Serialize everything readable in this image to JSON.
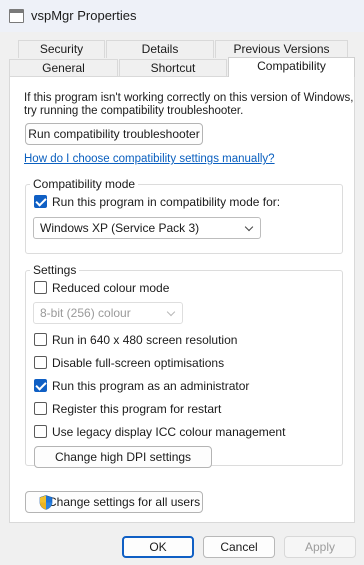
{
  "window": {
    "title": "vspMgr Properties"
  },
  "tabs": {
    "row1": [
      "Security",
      "Details",
      "Previous Versions"
    ],
    "row2": [
      "General",
      "Shortcut",
      "Compatibility"
    ],
    "active": "Compatibility"
  },
  "compat": {
    "intro_line1": "If this program isn't working correctly on this version of Windows,",
    "intro_line2": "try running the compatibility troubleshooter.",
    "troubleshooter_button": "Run compatibility troubleshooter",
    "help_link": "How do I choose compatibility settings manually?",
    "mode_group": {
      "title": "Compatibility mode",
      "checkbox_label": "Run this program in compatibility mode for:",
      "checked": true,
      "selected_os": "Windows XP (Service Pack 3)"
    },
    "settings_group": {
      "title": "Settings",
      "reduced_colour": {
        "label": "Reduced colour mode",
        "checked": false
      },
      "colour_depth": "8-bit (256) colour",
      "res640": {
        "label": "Run in 640 x 480 screen resolution",
        "checked": false
      },
      "disable_fullscreen": {
        "label": "Disable full-screen optimisations",
        "checked": false
      },
      "run_admin": {
        "label": "Run this program as an administrator",
        "checked": true
      },
      "register_restart": {
        "label": "Register this program for restart",
        "checked": false
      },
      "legacy_icc": {
        "label": "Use legacy display ICC colour management",
        "checked": false
      },
      "dpi_button": "Change high DPI settings"
    },
    "all_users_button": "Change settings for all users"
  },
  "footer": {
    "ok": "OK",
    "cancel": "Cancel",
    "apply": "Apply"
  },
  "icons": {
    "app": "window-icon",
    "shield": "uac-shield-icon"
  },
  "colors": {
    "accent": "#0f5fc4",
    "link": "#0a5fbf"
  }
}
